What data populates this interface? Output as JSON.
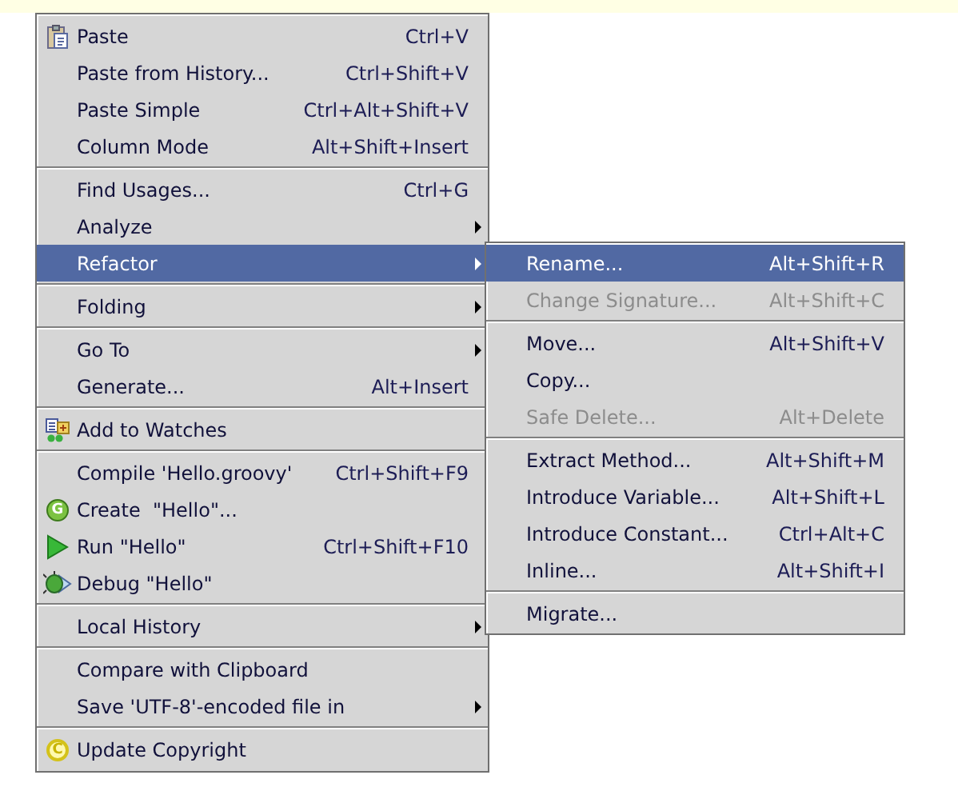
{
  "context_menu": {
    "groups": [
      {
        "items": [
          {
            "label": "Paste",
            "shortcut": "Ctrl+V",
            "kind": "paste",
            "submenu": false,
            "selected": false,
            "disabled": false
          },
          {
            "label": "Paste from History...",
            "shortcut": "Ctrl+Shift+V",
            "kind": "plain",
            "submenu": false,
            "selected": false,
            "disabled": false
          },
          {
            "label": "Paste Simple",
            "shortcut": "Ctrl+Alt+Shift+V",
            "kind": "plain",
            "submenu": false,
            "selected": false,
            "disabled": false
          },
          {
            "label": "Column Mode",
            "shortcut": "Alt+Shift+Insert",
            "kind": "plain",
            "submenu": false,
            "selected": false,
            "disabled": false
          }
        ]
      },
      {
        "items": [
          {
            "label": "Find Usages...",
            "shortcut": "Ctrl+G",
            "kind": "plain",
            "submenu": false,
            "selected": false,
            "disabled": false
          },
          {
            "label": "Analyze",
            "kind": "plain",
            "submenu": true,
            "selected": false,
            "disabled": false
          },
          {
            "label": "Refactor",
            "kind": "plain",
            "submenu": true,
            "selected": true,
            "disabled": false
          }
        ]
      },
      {
        "items": [
          {
            "label": "Folding",
            "kind": "plain",
            "submenu": true,
            "selected": false,
            "disabled": false
          }
        ]
      },
      {
        "items": [
          {
            "label": "Go To",
            "kind": "plain",
            "submenu": true,
            "selected": false,
            "disabled": false
          },
          {
            "label": "Generate...",
            "shortcut": "Alt+Insert",
            "kind": "plain",
            "submenu": false,
            "selected": false,
            "disabled": false
          }
        ]
      },
      {
        "items": [
          {
            "label": "Add to Watches",
            "kind": "watches",
            "submenu": false,
            "selected": false,
            "disabled": false
          }
        ]
      },
      {
        "items": [
          {
            "label": "Compile 'Hello.groovy'",
            "shortcut": "Ctrl+Shift+F9",
            "kind": "plain",
            "submenu": false,
            "selected": false,
            "disabled": false
          },
          {
            "label": "Create  \"Hello\"...",
            "kind": "groovy",
            "icon_letter": "G",
            "submenu": false,
            "selected": false,
            "disabled": false
          },
          {
            "label": "Run \"Hello\"",
            "shortcut": "Ctrl+Shift+F10",
            "kind": "run",
            "submenu": false,
            "selected": false,
            "disabled": false
          },
          {
            "label": "Debug \"Hello\"",
            "kind": "debug",
            "submenu": false,
            "selected": false,
            "disabled": false
          }
        ]
      },
      {
        "items": [
          {
            "label": "Local History",
            "kind": "plain",
            "submenu": true,
            "selected": false,
            "disabled": false
          }
        ]
      },
      {
        "items": [
          {
            "label": "Compare with Clipboard",
            "kind": "plain",
            "submenu": false,
            "selected": false,
            "disabled": false
          },
          {
            "label": "Save 'UTF-8'-encoded file in",
            "kind": "plain",
            "submenu": true,
            "selected": false,
            "disabled": false
          }
        ]
      },
      {
        "items": [
          {
            "label": "Update Copyright",
            "kind": "copyright",
            "icon_letter": "C",
            "submenu": false,
            "selected": false,
            "disabled": false
          }
        ]
      }
    ]
  },
  "refactor_submenu": {
    "groups": [
      {
        "items": [
          {
            "label": "Rename...",
            "shortcut": "Alt+Shift+R",
            "selected": true,
            "disabled": false
          },
          {
            "label": "Change Signature...",
            "shortcut": "Alt+Shift+C",
            "selected": false,
            "disabled": true
          }
        ]
      },
      {
        "items": [
          {
            "label": "Move...",
            "shortcut": "Alt+Shift+V",
            "selected": false,
            "disabled": false
          },
          {
            "label": "Copy...",
            "selected": false,
            "disabled": false
          },
          {
            "label": "Safe Delete...",
            "shortcut": "Alt+Delete",
            "selected": false,
            "disabled": true
          }
        ]
      },
      {
        "items": [
          {
            "label": "Extract Method...",
            "shortcut": "Alt+Shift+M",
            "selected": false,
            "disabled": false
          },
          {
            "label": "Introduce Variable...",
            "shortcut": "Alt+Shift+L",
            "selected": false,
            "disabled": false
          },
          {
            "label": "Introduce Constant...",
            "shortcut": "Ctrl+Alt+C",
            "selected": false,
            "disabled": false
          },
          {
            "label": "Inline...",
            "shortcut": "Alt+Shift+I",
            "selected": false,
            "disabled": false
          }
        ]
      },
      {
        "items": [
          {
            "label": "Migrate...",
            "selected": false,
            "disabled": false
          }
        ]
      }
    ]
  }
}
